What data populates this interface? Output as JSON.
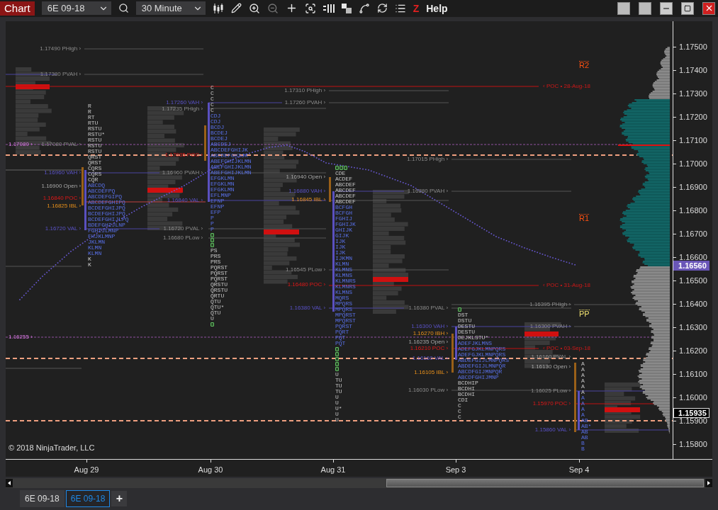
{
  "toolbar": {
    "title": "Chart",
    "instrument": "6E 09-18",
    "interval": "30 Minute",
    "hotkey": "Z",
    "help": "Help"
  },
  "levels": [
    {
      "text": "1.17490 PHigh ›",
      "kind": "prior"
    },
    {
      "text": "1.17380 PVAH ›",
      "kind": "prior"
    },
    {
      "text": "‹ POC • 28-Aug-18",
      "kind": "naked_poc"
    },
    {
      "text": "1.17310 PHigh ›",
      "kind": "prior"
    },
    {
      "text": "1.17260 VAH ›",
      "kind": "value"
    },
    {
      "text": "1.17260 PVAH ›",
      "kind": "prior"
    },
    {
      "text": "1.17235 PHigh ›",
      "kind": "prior"
    },
    {
      "text": "1.17080 ›",
      "kind": "marker"
    },
    {
      "text": "1.17080 PVAL ›",
      "kind": "prior"
    },
    {
      "text": "1.17035 POC ›",
      "kind": "poc"
    },
    {
      "text": "1.17015 PHigh ›",
      "kind": "prior"
    },
    {
      "text": "1.16960 VAH ›",
      "kind": "value"
    },
    {
      "text": "1.16960 PVAH ›",
      "kind": "prior"
    },
    {
      "text": "1.16940 Open ›",
      "kind": "open"
    },
    {
      "text": "1.16900 Open ›",
      "kind": "open"
    },
    {
      "text": "1.16880 VAH ›",
      "kind": "value"
    },
    {
      "text": "1.16880 PVAH ›",
      "kind": "prior"
    },
    {
      "text": "1.16845 IBL ›",
      "kind": "ib"
    },
    {
      "text": "1.16840 POC ›",
      "kind": "poc"
    },
    {
      "text": "1.16840 VAL ›",
      "kind": "value"
    },
    {
      "text": "1.16825 IBL ›",
      "kind": "ib"
    },
    {
      "text": "1.16720 VAL ›",
      "kind": "value"
    },
    {
      "text": "1.16720 PVAL ›",
      "kind": "prior"
    },
    {
      "text": "1.16680 PLow ›",
      "kind": "prior"
    },
    {
      "text": "1.16545 PLow ›",
      "kind": "prior"
    },
    {
      "text": "1.16480 POC ›",
      "kind": "poc"
    },
    {
      "text": "‹ POC • 31-Aug-18",
      "kind": "naked_poc"
    },
    {
      "text": "1.16395 PHigh ›",
      "kind": "prior"
    },
    {
      "text": "1.16380 VAL ›",
      "kind": "value"
    },
    {
      "text": "1.16380 PVAL ›",
      "kind": "prior"
    },
    {
      "text": "1.16300 VAH ›",
      "kind": "value"
    },
    {
      "text": "1.16300 PVAH ›",
      "kind": "prior"
    },
    {
      "text": "1.16270 IBH ›",
      "kind": "ib"
    },
    {
      "text": "1.16255 ›",
      "kind": "marker"
    },
    {
      "text": "1.16235 Open ›",
      "kind": "open"
    },
    {
      "text": "1.16210 POC ›",
      "kind": "poc"
    },
    {
      "text": "‹ POC • 03-Sep-18",
      "kind": "naked_poc"
    },
    {
      "text": "1.16160 VAL ›",
      "kind": "value"
    },
    {
      "text": "1.16160 PVAL ›",
      "kind": "prior"
    },
    {
      "text": "1.16130 Open ›",
      "kind": "open"
    },
    {
      "text": "1.16105 IBL ›",
      "kind": "ib"
    },
    {
      "text": "1.16030 PLow ›",
      "kind": "prior"
    },
    {
      "text": "1.16025 PLow ›",
      "kind": "prior"
    },
    {
      "text": "1.15970 POC ›",
      "kind": "poc"
    },
    {
      "text": "1.15860 VAL ›",
      "kind": "value"
    }
  ],
  "profiles": [
    {
      "upper": [
        "R",
        "R",
        "RT",
        "RTU",
        "RSTU",
        "RSTU*",
        "RSTU",
        "RSTU",
        "RSTU",
        "QRST",
        "QRST",
        "CQRS",
        "CQRS",
        "CQR"
      ],
      "value_area": [
        "ABCDQ",
        "ABCDEFPQ",
        "ABCDEFGIPQ",
        "ABCDEFGHIPQ",
        "BCDEFGHIJPQ",
        "BCDEFGHIJPQ",
        "BCDEFGHIJLPQ",
        "BDEFGHIJLNP",
        "FGHIJLMNP",
        "FHJKLMNP",
        "JKLMN",
        "KLMN",
        "KLMN"
      ],
      "lower": [
        "K",
        "K"
      ]
    },
    {
      "upper": [
        "C",
        "C",
        "C",
        "C",
        "C"
      ],
      "value_area": [
        "CDJ",
        "CDJ",
        "BCDJ",
        "BCDEJ",
        "BCDEJ",
        "ABCDEJ",
        "ABCDEFGHIJK",
        "ABCDEFGHIJK",
        "ABEFGHIJKLMN",
        "ABEFGHIJKLMN",
        "ABEFGHIJKLMN",
        "EFGKLMN",
        "EFGKLMN",
        "EFGKLMN",
        "EFLMNP",
        "EFNP",
        "EFNP",
        "EFP",
        "P",
        "P",
        "P"
      ],
      "lower": [
        "PS",
        "PRS",
        "PRS",
        "PQRST",
        "PQRST",
        "PQRST",
        "QRSTU",
        "QRSTU",
        "QRTU",
        "QTU",
        "QTU*",
        "QTU",
        "U"
      ]
    },
    {
      "upper": [
        "CDE",
        "ACDEF",
        "ABCDEF",
        "ABCDEF",
        "ABCDEF",
        "ABCDEF"
      ],
      "value_area": [
        "BCFGH",
        "BCFGH",
        "FGHIJ",
        "FGHIJK",
        "GHIJK",
        "GIJK",
        "IJK",
        "IJK",
        "IJK",
        "IJKMN",
        "KLMN",
        "KLMNS",
        "KLMNS",
        "KLMNRS",
        "KLMNRS",
        "KLMNS",
        "MQRS",
        "MPQRS",
        "MPQRS",
        "MPQRST",
        "MPQRST",
        "PQRST",
        "PQRT",
        "PQT",
        "PQT"
      ],
      "lower": [
        "U",
        "TU",
        "TU",
        "TU",
        "U",
        "U",
        "U*",
        "U",
        "U"
      ]
    },
    {
      "upper": [
        "DST",
        "DSTU",
        "DESTU",
        "DESTU",
        "DEJKLSTU*"
      ],
      "value_area": [
        "ADEFJKLMNS",
        "ADEFGJKLMNPQRS",
        "ADEFGJKLMNPQRS",
        "ABDEFGIJLMNPQRS",
        "ABDEFGIJLMNPQR",
        "ABCDFGIJMNPQR",
        "ABCDFGHIJMNP"
      ],
      "lower": [
        "BCDHIP",
        "BCDHI",
        "BCDHI",
        "CDI",
        "C",
        "C",
        "C"
      ]
    },
    {
      "upper": [
        "A",
        "A",
        "A",
        "A",
        "A",
        "A"
      ],
      "value_area": [
        "A",
        "A",
        "A",
        "A",
        "AB",
        "AB*",
        "AB",
        "AB",
        "B",
        "B"
      ]
    }
  ],
  "pivots": [
    {
      "label": "R2",
      "kind": "resistance"
    },
    {
      "label": "R1",
      "kind": "resistance"
    },
    {
      "label": "PP",
      "kind": "pivot"
    }
  ],
  "copyright": "© 2018 NinjaTrader, LLC",
  "price_axis": {
    "ticks": [
      "1.17500",
      "1.17400",
      "1.17300",
      "1.17200",
      "1.17100",
      "1.17000",
      "1.16900",
      "1.16800",
      "1.16700",
      "1.16600",
      "1.16500",
      "1.16400",
      "1.16300",
      "1.16200",
      "1.16100",
      "1.16000",
      "1.15900",
      "1.15800"
    ],
    "markers": [
      {
        "text": "1.16560",
        "kind": "current"
      },
      {
        "text": "1.15935",
        "kind": "last"
      }
    ]
  },
  "time_axis": [
    "Aug 29",
    "Aug 30",
    "Aug 31",
    "Sep 3",
    "Sep 4"
  ],
  "tabs": [
    {
      "label": "6E 09-18",
      "selected": false
    },
    {
      "label": "6E 09-18",
      "selected": true
    }
  ],
  "add_tab": "+"
}
